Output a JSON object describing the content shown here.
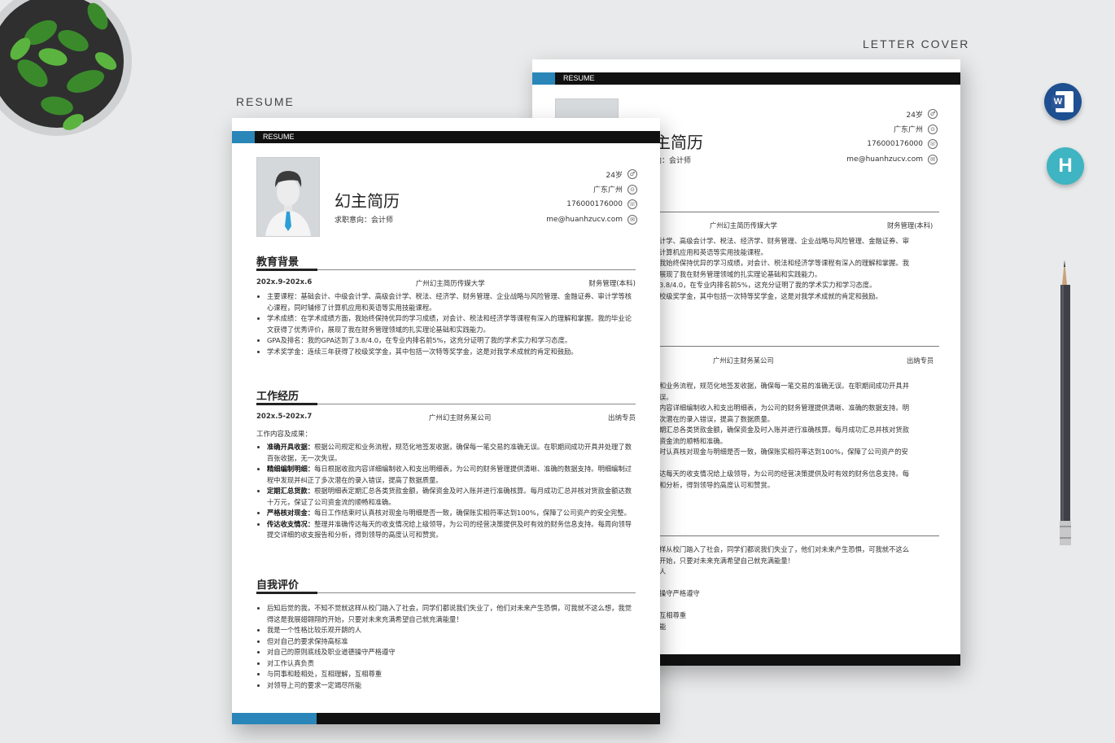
{
  "captions": {
    "resume": "RESUME",
    "letter": "LETTER COVER"
  },
  "icons": {
    "word": "word-doc-icon",
    "h": "h-app-icon"
  },
  "colors": {
    "accent": "#2a86b8",
    "bar": "#111111"
  },
  "front": {
    "header_label": "RESUME",
    "name": "幻主简历",
    "intent": "求职意向：会计师",
    "contact": [
      "24岁",
      "广东广州",
      "176000176000",
      "me@huanhzucv.com"
    ],
    "education": {
      "title": "教育背景",
      "date": "202x.9-202x.6",
      "school": "广州幻主简历传媒大学",
      "major": "财务管理(本科)",
      "items": [
        "主要课程：基础会计、中级会计学、高级会计学、税法、经济学、财务管理、企业战略与风险管理、金融证券、审计学等核心课程，同时辅修了计算机应用和英语等实用技能课程。",
        "学术成绩：在学术成绩方面，我始终保持优异的学习成绩，对会计、税法和经济学等课程有深入的理解和掌握。我的毕业论文获得了优秀评价，展现了我在财务管理领域的扎实理论基础和实践能力。",
        "GPA及排名：我的GPA达到了3.8/4.0，在专业内排名前5%，这充分证明了我的学术实力和学习态度。",
        "学术奖学金：连续三年获得了校级奖学金，其中包括一次特等奖学金，这是对我学术成就的肯定和鼓励。"
      ]
    },
    "work": {
      "title": "工作经历",
      "date": "202x.5-202x.7",
      "company": "广州幻主财务某公司",
      "role": "出纳专员",
      "subtitle": "工作内容及成果：",
      "items": [
        {
          "k": "准确开具收据：",
          "v": "根据公司规定和业务流程，规范化地签发收据，确保每一笔交易的准确无误。在职期间成功开具并处理了数百张收据，无一次失误。"
        },
        {
          "k": "精细编制明细：",
          "v": "每日根据收款内容详细编制收入和支出明细表，为公司的财务管理提供清晰、准确的数据支持。明细编制过程中发现并纠正了多次潜在的录入错误，提高了数据质量。"
        },
        {
          "k": "定期汇总货款：",
          "v": "根据明细表定期汇总各类货款金额，确保资金及时入账并进行准确核算。每月成功汇总并核对货款金额达数十万元，保证了公司资金流的顺畅和准确。"
        },
        {
          "k": "严格核对现金：",
          "v": "每日工作结束时认真核对现金与明细是否一致，确保账实相符率达到100%，保障了公司资产的安全完整。"
        },
        {
          "k": "传达收支情况：",
          "v": "整理并准确传达每天的收支情况给上级领导，为公司的经营决策提供及时有效的财务信息支持。每周向领导提交详细的收支报告和分析，得到领导的高度认可和赞赏。"
        }
      ]
    },
    "self": {
      "title": "自我评价",
      "items": [
        "后知后觉的我，不知不觉就这样从校门踏入了社会，同学们都说我们失业了，他们对未来产生恐惧，可我就不这么想，我觉得这是我展翅翱翔的开始，只要对未来充满希望自己就充满能量！",
        "我是一个性格比较乐观开朗的人",
        "但对自己的要求保持高标准",
        "对自己的原则底线及职业道德操守严格遵守",
        "对工作认真负责",
        "与同事和睦相处，互相理解，互相尊重",
        "对领导上司的要求一定竭尽所能"
      ]
    }
  },
  "back": {
    "header_label": "RESUME",
    "name_partial": "主简历",
    "intent_partial": "向：会计师",
    "contact": [
      "24岁",
      "广东广州",
      "176000176000",
      "me@huanhzucv.com"
    ],
    "edu_school": "广州幻主简历传媒大学",
    "edu_major": "财务管理(本科)",
    "edu_lines": [
      "计学、高级会计学、税法、经济学、财务管理、企业战略与风险管理、金融证券、审",
      "计算机应用和英语等实用技能课程。",
      "我始终保持优异的学习成绩，对会计、税法和经济学等课程有深入的理解和掌握。我",
      "展现了我在财务管理领域的扎实理论基础和实践能力。",
      "3.8/4.0，在专业内排名前5%，这充分证明了我的学术实力和学习态度。",
      "校级奖学金，其中包括一次特等奖学金，这是对我学术成就的肯定和鼓励。"
    ],
    "work_company": "广州幻主财务某公司",
    "work_role": "出纳专员",
    "work_lines": [
      "和业务流程，规范化地签发收据，确保每一笔交易的准确无误。在职期间成功开具并",
      "误。",
      "内容详细编制收入和支出明细表，为公司的财务管理提供清晰、准确的数据支持。明",
      "次潜在的录入错误，提高了数据质量。",
      "期汇总各类货款金额，确保资金及时入账并进行准确核算。每月成功汇总并核对货款",
      "资金流的顺畅和准确。",
      "时认真核对现金与明细是否一致，确保账实相符率达到100%，保障了公司资产的安",
      "",
      "达每天的收支情况给上级领导，为公司的经营决策提供及时有效的财务信息支持。每",
      "和分析，得到领导的高度认可和赞赏。"
    ],
    "self_lines": [
      "样从校门踏入了社会，同学们都说我们失业了，他们对未来产生恐惧，可我就不这么",
      "开始，只要对未来充满希望自己就充满能量！",
      "人",
      "",
      "操守严格遵守",
      "",
      "互相尊重",
      "能"
    ]
  }
}
